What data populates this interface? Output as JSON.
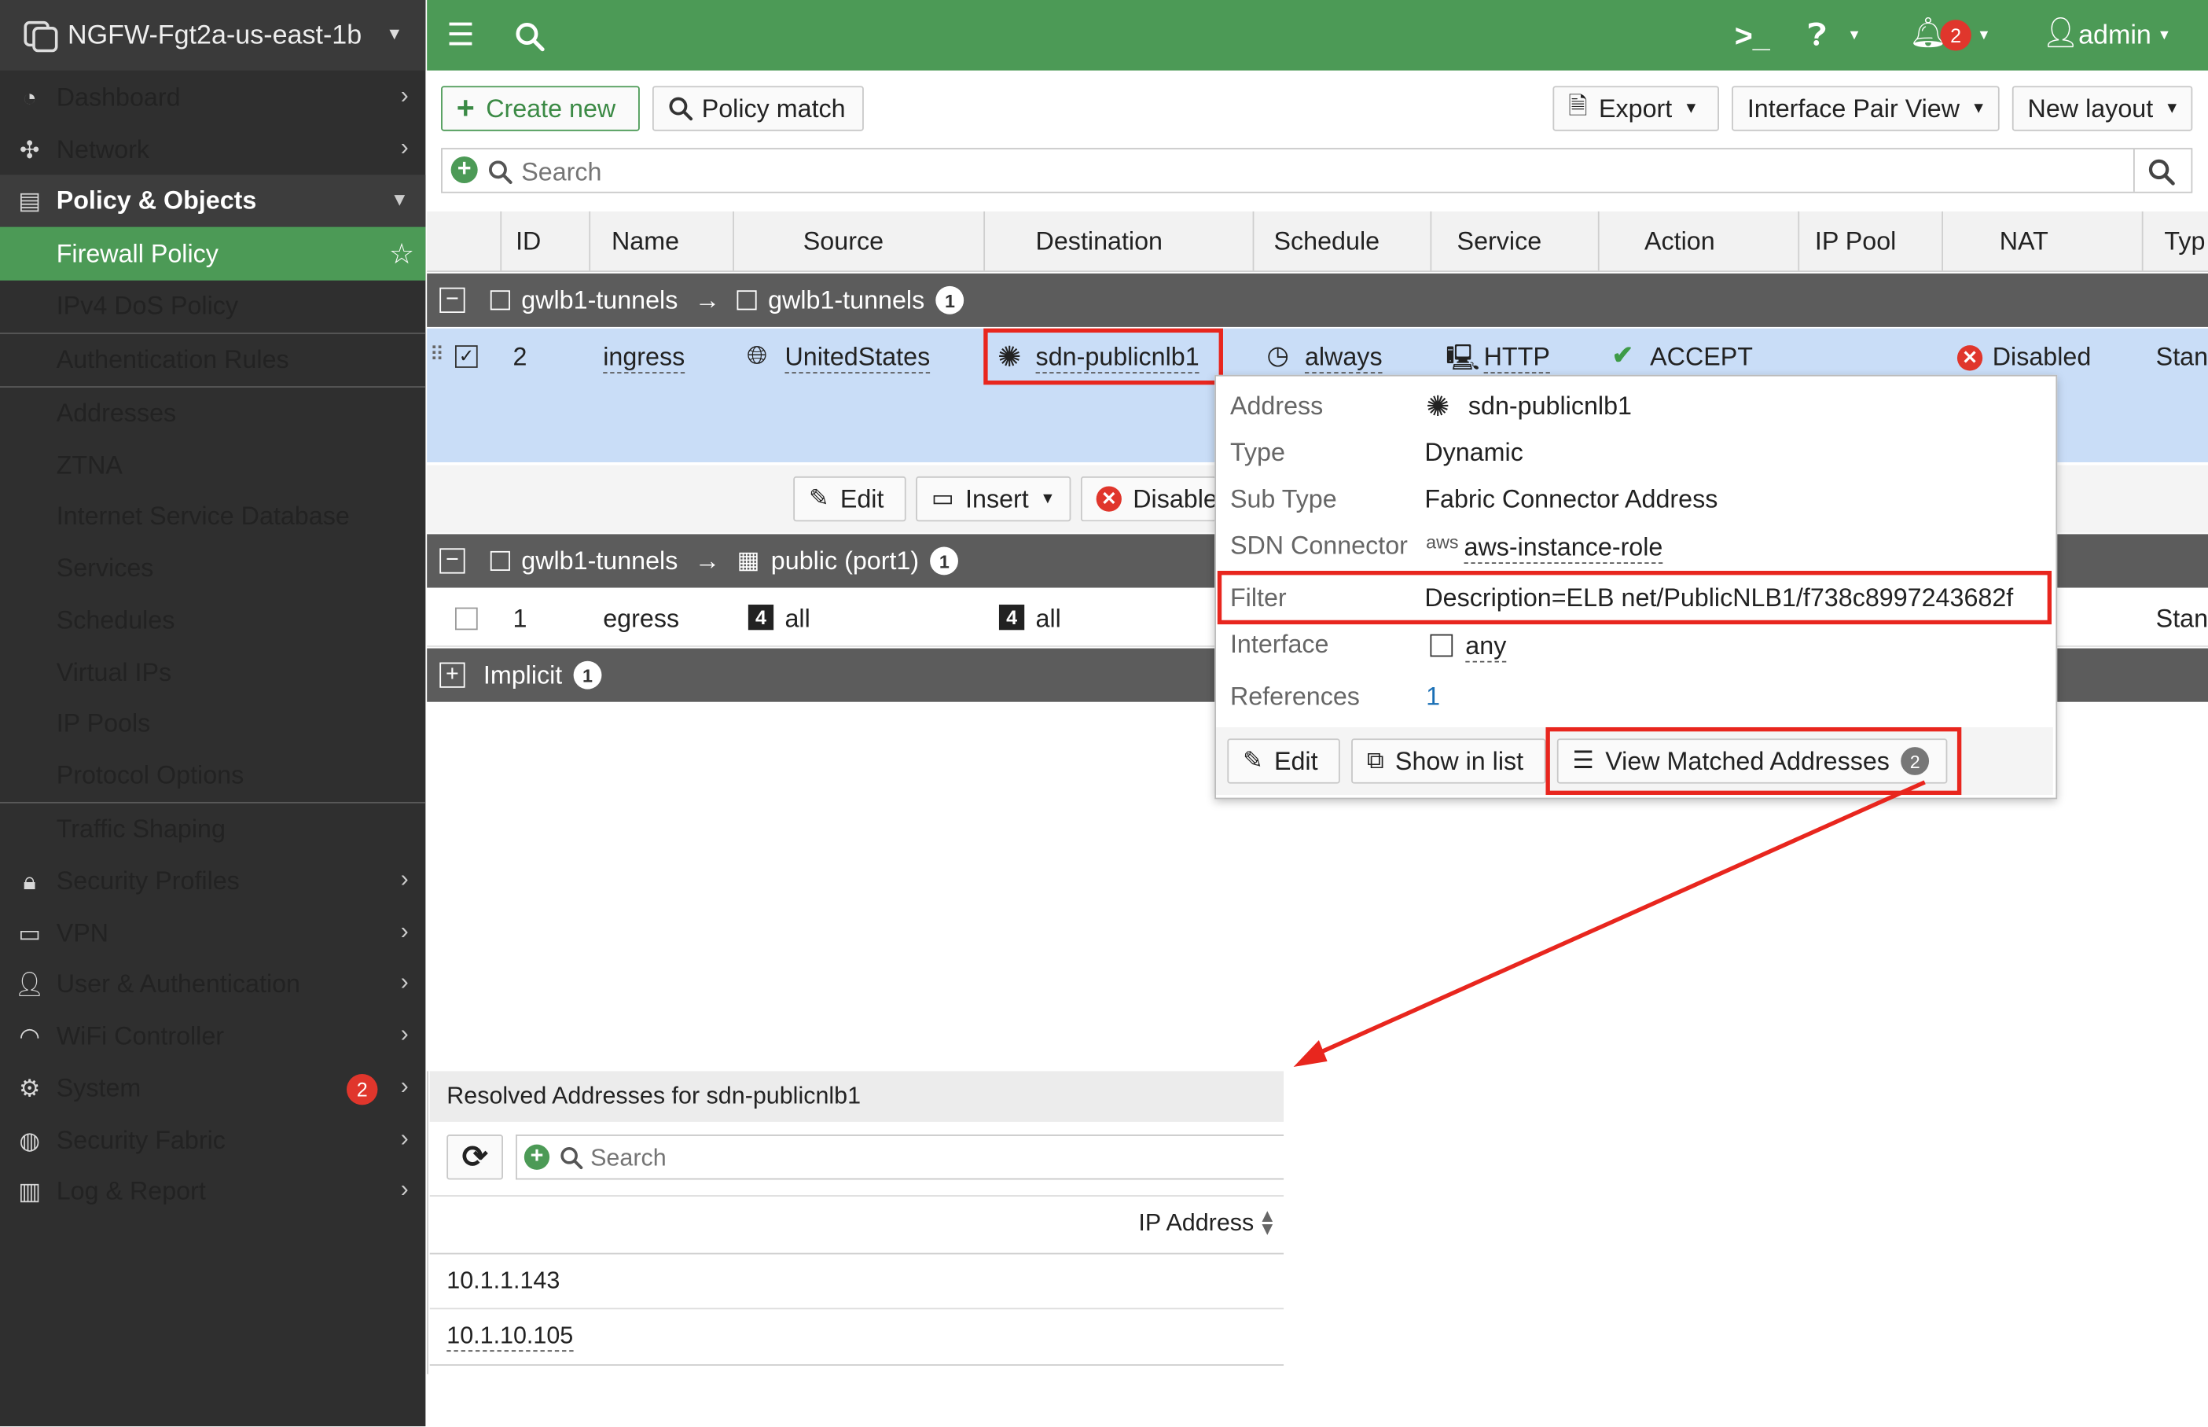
{
  "sidebar": {
    "device": "NGFW-Fgt2a-us-east-1b",
    "items": [
      {
        "label": "Dashboard",
        "icon": "dashboard-icon"
      },
      {
        "label": "Network",
        "icon": "network-icon"
      },
      {
        "label": "Policy & Objects",
        "icon": "policy-icon"
      },
      {
        "label": "Firewall Policy"
      },
      {
        "label": "IPv4 DoS Policy"
      },
      {
        "label": "Authentication Rules"
      },
      {
        "label": "Addresses"
      },
      {
        "label": "ZTNA"
      },
      {
        "label": "Internet Service Database"
      },
      {
        "label": "Services"
      },
      {
        "label": "Schedules"
      },
      {
        "label": "Virtual IPs"
      },
      {
        "label": "IP Pools"
      },
      {
        "label": "Protocol Options"
      },
      {
        "label": "Traffic Shaping"
      },
      {
        "label": "Security Profiles",
        "icon": "lock-icon"
      },
      {
        "label": "VPN",
        "icon": "laptop-icon"
      },
      {
        "label": "User & Authentication",
        "icon": "user-icon"
      },
      {
        "label": "WiFi Controller",
        "icon": "wifi-icon"
      },
      {
        "label": "System",
        "icon": "gear-icon",
        "badge": "2"
      },
      {
        "label": "Security Fabric",
        "icon": "fabric-icon"
      },
      {
        "label": "Log & Report",
        "icon": "chart-icon"
      }
    ]
  },
  "topbar": {
    "notifications": "2",
    "user": "admin",
    "color": "#4c9a56"
  },
  "toolbar": {
    "create_new": "Create new",
    "policy_match": "Policy match",
    "export": "Export",
    "interface_pair_view": "Interface Pair View",
    "new_layout": "New layout",
    "search_placeholder": "Search"
  },
  "table": {
    "headers": [
      "ID",
      "Name",
      "Source",
      "Destination",
      "Schedule",
      "Service",
      "Action",
      "IP Pool",
      "NAT",
      "Typ"
    ],
    "groups": [
      {
        "from": "gwlb1-tunnels",
        "to": "gwlb1-tunnels",
        "count": "1"
      },
      {
        "from": "gwlb1-tunnels",
        "to": "public (port1)",
        "count": "1"
      },
      {
        "label": "Implicit",
        "count": "1"
      }
    ],
    "rows": [
      {
        "id": "2",
        "name": "ingress",
        "source": "UnitedStates",
        "destination": "sdn-publicnlb1",
        "schedule": "always",
        "service": "HTTP",
        "action": "ACCEPT",
        "nat": "Disabled",
        "type": "Stan"
      },
      {
        "id": "1",
        "name": "egress",
        "source": "all",
        "destination": "all",
        "type": "Stan"
      }
    ],
    "row_actions": {
      "edit": "Edit",
      "insert": "Insert",
      "disable": "Disable"
    }
  },
  "popup": {
    "fields": [
      {
        "key": "Address",
        "value": "sdn-publicnlb1"
      },
      {
        "key": "Type",
        "value": "Dynamic"
      },
      {
        "key": "Sub Type",
        "value": "Fabric Connector Address"
      },
      {
        "key": "SDN Connector",
        "value": "aws-instance-role"
      },
      {
        "key": "Filter",
        "value": "Description=ELB net/PublicNLB1/f738c8997243682f"
      },
      {
        "key": "Interface",
        "value": "any"
      },
      {
        "key": "References",
        "value": "1"
      }
    ],
    "edit": "Edit",
    "show_in_list": "Show in list",
    "view_matched": "View Matched Addresses",
    "matched_count": "2"
  },
  "resolved": {
    "title": "Resolved Addresses for sdn-publicnlb1",
    "search_placeholder": "Search",
    "column": "IP Address",
    "rows": [
      "10.1.1.143",
      "10.1.10.105"
    ]
  },
  "colors": {
    "accent": "#4c9a56",
    "highlight": "#e8261e",
    "selected_row": "#c9ddf7"
  }
}
